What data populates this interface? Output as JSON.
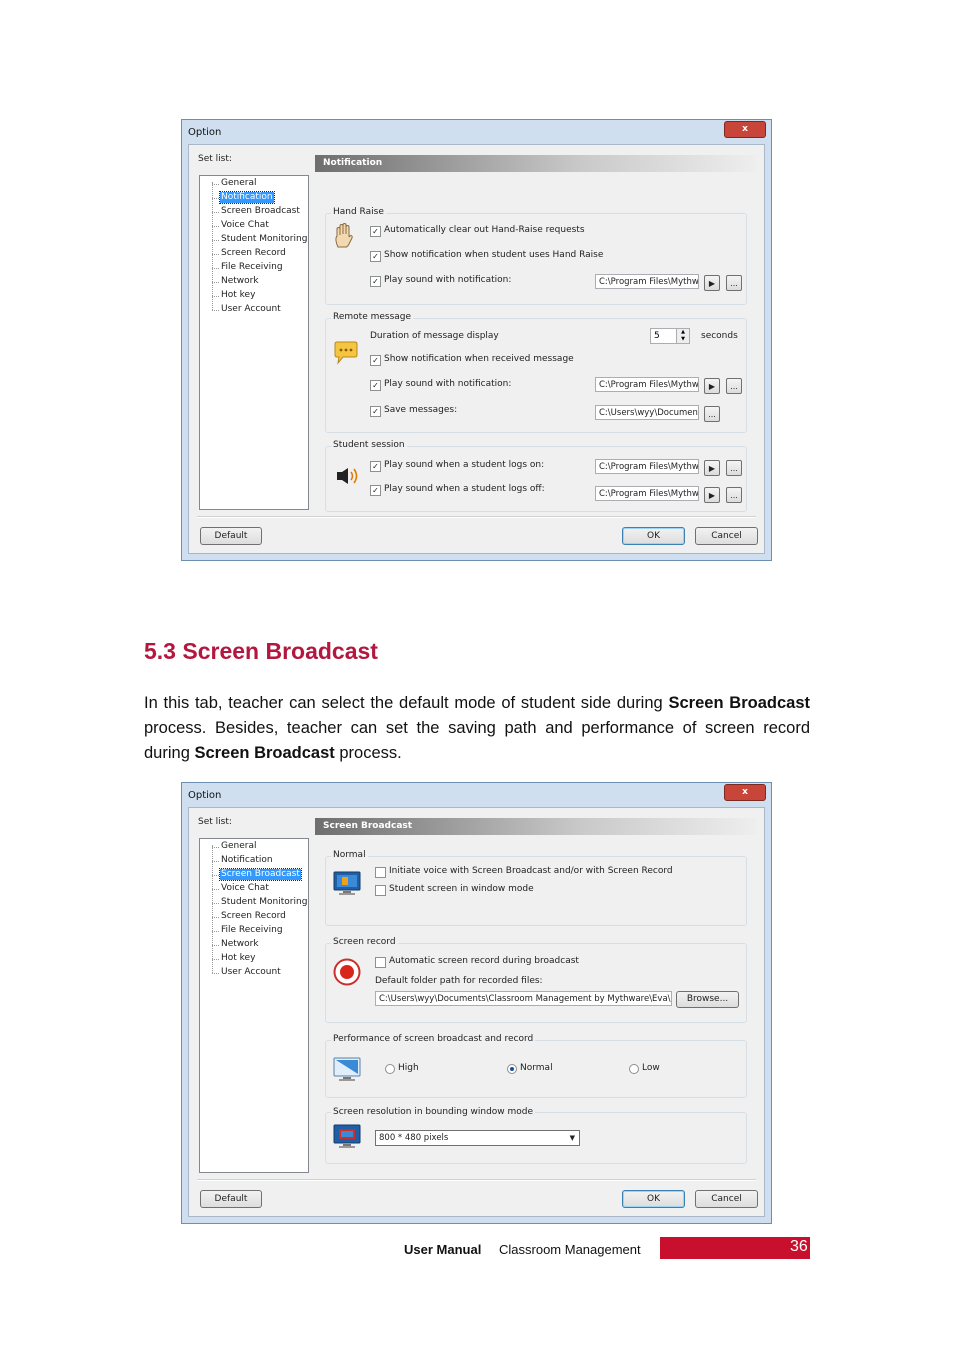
{
  "dialog1": {
    "title": "Option",
    "close_label": "x",
    "setlist_label": "Set list:",
    "tree": [
      "General",
      "Notification",
      "Screen Broadcast",
      "Voice Chat",
      "Student Monitoring",
      "Screen Record",
      "File Receiving",
      "Network",
      "Hot key",
      "User Account"
    ],
    "selected": "Notification",
    "header": "Notification",
    "hand_raise": {
      "title": "Hand Raise",
      "opt1": "Automatically clear out Hand-Raise requests",
      "opt2": "Show notification when student uses Hand Raise",
      "opt3": "Play sound with notification:",
      "path": "C:\\Program Files\\Mythw"
    },
    "remote": {
      "title": "Remote message",
      "duration_label": "Duration of message display",
      "duration_value": "5",
      "seconds": "seconds",
      "opt1": "Show notification when received message",
      "opt2": "Play sound with notification:",
      "path2": "C:\\Program Files\\Mythw",
      "opt3": "Save messages:",
      "path3": "C:\\Users\\wyy\\Documen"
    },
    "session": {
      "title": "Student session",
      "opt1": "Play sound when a student logs on:",
      "path1": "C:\\Program Files\\Mythw",
      "opt2": "Play sound when a student logs off:",
      "path2": "C:\\Program Files\\Mythw"
    },
    "play_btn": "▶",
    "browse_btn": "...",
    "default_btn": "Default",
    "ok_btn": "OK",
    "cancel_btn": "Cancel"
  },
  "section": {
    "heading": "5.3  Screen Broadcast",
    "p1": "In this tab, teacher can select the default mode of student side during ",
    "b1": "Screen Broadcast",
    "p2": " process. Besides, teacher can set the saving path and performance of screen record during ",
    "b2": "Screen Broadcast",
    "p3": " process."
  },
  "dialog2": {
    "title": "Option",
    "close_label": "x",
    "setlist_label": "Set list:",
    "tree": [
      "General",
      "Notification",
      "Screen Broadcast",
      "Voice Chat",
      "Student Monitoring",
      "Screen Record",
      "File Receiving",
      "Network",
      "Hot key",
      "User Account"
    ],
    "selected": "Screen Broadcast",
    "header": "Screen Broadcast",
    "normal": {
      "title": "Normal",
      "opt1": "Initiate voice with Screen Broadcast and/or with Screen Record",
      "opt2": "Student screen in window mode"
    },
    "record": {
      "title": "Screen record",
      "opt1": "Automatic screen record during broadcast",
      "folder_label": "Default folder path for recorded files:",
      "path": "C:\\Users\\wyy\\Documents\\Classroom Management by Mythware\\Eva\\R",
      "browse": "Browse..."
    },
    "performance": {
      "title": "Performance of screen broadcast and record",
      "high": "High",
      "normal": "Normal",
      "low": "Low",
      "selected": "Normal"
    },
    "resolution": {
      "title": "Screen resolution in bounding window mode",
      "value": "800 * 480 pixels"
    },
    "default_btn": "Default",
    "ok_btn": "OK",
    "cancel_btn": "Cancel"
  },
  "footer": {
    "manual": "User  Manual",
    "product": "Classroom  Management",
    "page": "36"
  },
  "colors": {
    "accent": "#b3173f",
    "footer_bar": "#c8102e",
    "selection": "#3399ff"
  }
}
